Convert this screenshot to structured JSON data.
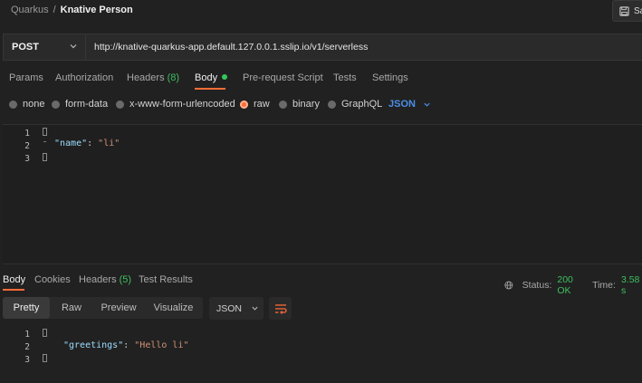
{
  "breadcrumb": {
    "root": "Quarkus",
    "separator": "/",
    "current": "Knative Person"
  },
  "toolbar": {
    "save_label": "Sa"
  },
  "request": {
    "method": "POST",
    "url": "http://knative-quarkus-app.default.127.0.0.1.sslip.io/v1/serverless"
  },
  "request_tabs": {
    "params": "Params",
    "authorization": "Authorization",
    "headers": "Headers",
    "headers_count": "(8)",
    "body": "Body",
    "prerequest": "Pre-request Script",
    "tests": "Tests",
    "settings": "Settings"
  },
  "body_types": {
    "none": "none",
    "form_data": "form-data",
    "urlencoded": "x-www-form-urlencoded",
    "raw": "raw",
    "binary": "binary",
    "graphql": "GraphQL",
    "selected": "raw",
    "language": "JSON"
  },
  "request_body": {
    "line_numbers": [
      "1",
      "2",
      "3"
    ],
    "key": "\"name\"",
    "colon": ": ",
    "value": "\"li\""
  },
  "response_tabs": {
    "body": "Body",
    "cookies": "Cookies",
    "headers": "Headers",
    "headers_count": "(5)",
    "test_results": "Test Results"
  },
  "response_status": {
    "status_label": "Status:",
    "status_value": "200 OK",
    "time_label": "Time:",
    "time_value": "3.58 s"
  },
  "response_view": {
    "pretty": "Pretty",
    "raw": "Raw",
    "preview": "Preview",
    "visualize": "Visualize",
    "format": "JSON"
  },
  "response_body": {
    "line_numbers": [
      "1",
      "2",
      "3"
    ],
    "key": "\"greetings\"",
    "colon": ": ",
    "value": "\"Hello li\""
  },
  "colors": {
    "accent": "#ff6c37",
    "success": "#3fbf60",
    "link": "#4a8fe7"
  }
}
